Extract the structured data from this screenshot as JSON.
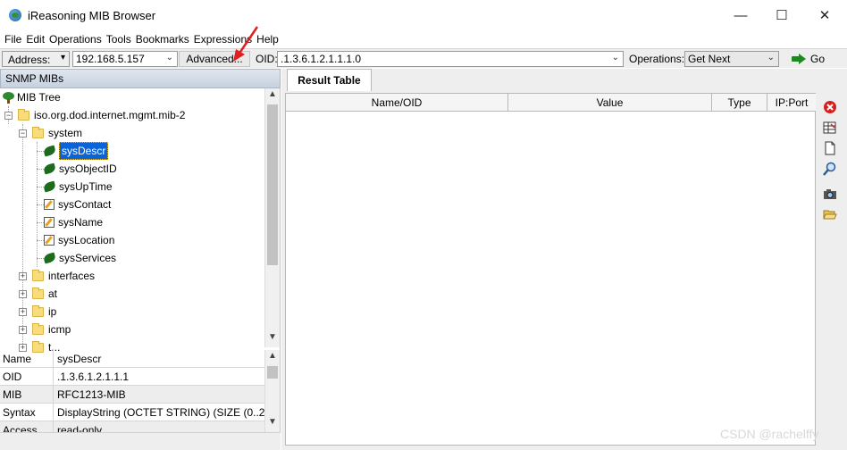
{
  "window": {
    "title": "iReasoning MIB Browser",
    "minimize": "—",
    "maximize": "☐",
    "close": "✕"
  },
  "menu": [
    "File",
    "Edit",
    "Operations",
    "Tools",
    "Bookmarks",
    "Expressions",
    "Help"
  ],
  "toolbar": {
    "address_label": "Address:",
    "address_value": "192.168.5.157",
    "advanced_label": "Advanced...",
    "oid_label": "OID:",
    "oid_value": ".1.3.6.1.2.1.1.1.0",
    "operations_label": "Operations:",
    "operation_value": "Get Next",
    "go_label": "Go"
  },
  "left_panel": {
    "header": "SNMP MIBs",
    "tree_root": "MIB Tree",
    "tree": [
      {
        "label": "iso.org.dod.internet.mgmt.mib-2",
        "type": "folder",
        "expander": "⊟"
      },
      {
        "label": "system",
        "type": "folder",
        "expander": "⊟"
      },
      {
        "label": "sysDescr",
        "type": "leaf",
        "selected": true
      },
      {
        "label": "sysObjectID",
        "type": "leaf"
      },
      {
        "label": "sysUpTime",
        "type": "leaf"
      },
      {
        "label": "sysContact",
        "type": "writable"
      },
      {
        "label": "sysName",
        "type": "writable"
      },
      {
        "label": "sysLocation",
        "type": "writable"
      },
      {
        "label": "sysServices",
        "type": "leaf"
      },
      {
        "label": "interfaces",
        "type": "folder",
        "expander": "⊞"
      },
      {
        "label": "at",
        "type": "folder",
        "expander": "⊞"
      },
      {
        "label": "ip",
        "type": "folder",
        "expander": "⊞"
      },
      {
        "label": "icmp",
        "type": "folder",
        "expander": "⊞"
      },
      {
        "label": "t...",
        "type": "folder",
        "expander": "⊞"
      }
    ],
    "properties": [
      {
        "name": "Name",
        "value": "sysDescr"
      },
      {
        "name": "OID",
        "value": ".1.3.6.1.2.1.1.1"
      },
      {
        "name": "MIB",
        "value": "RFC1213-MIB"
      },
      {
        "name": "Syntax",
        "value": "DisplayString (OCTET STRING) (SIZE (0..2..."
      },
      {
        "name": "Access",
        "value": "read-only"
      }
    ]
  },
  "right_panel": {
    "tab": "Result Table",
    "columns": [
      "Name/OID",
      "Value",
      "Type",
      "IP:Port"
    ],
    "side_tools": [
      "delete-icon",
      "grid-icon",
      "document-icon",
      "find-icon",
      "camera-icon",
      "open-folder-icon"
    ]
  },
  "watermark": "CSDN @rachelffy",
  "colors": {
    "selection": "#0a64d8",
    "header_bg": "#c7d2df",
    "go_green": "#1c8a1c",
    "annotation_red": "#e02020"
  }
}
